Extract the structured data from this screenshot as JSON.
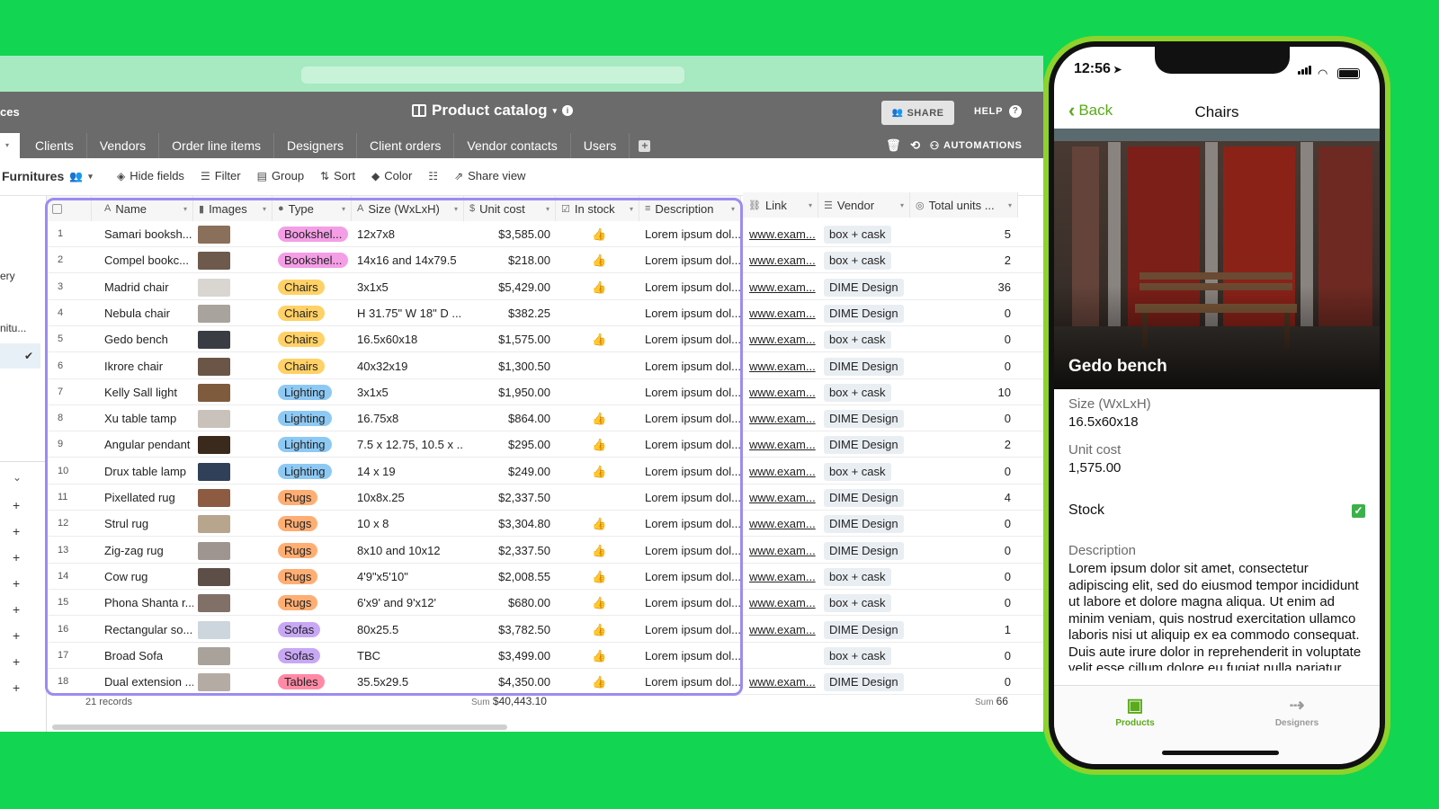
{
  "app": {
    "header_cut_text": "ces",
    "base_title": "Product catalog",
    "share_label": "SHARE",
    "help_label": "HELP",
    "automations_label": "AUTOMATIONS",
    "tabs": [
      "Clients",
      "Vendors",
      "Order line items",
      "Designers",
      "Client orders",
      "Vendor contacts",
      "Users"
    ],
    "view_name": "Furnitures",
    "toolbar": {
      "hide_fields": "Hide fields",
      "filter": "Filter",
      "group": "Group",
      "sort": "Sort",
      "color": "Color",
      "share_view": "Share view"
    },
    "left_strip": {
      "item1": "ery",
      "item2": "nitu..."
    }
  },
  "grid": {
    "columns": {
      "name": "Name",
      "images": "Images",
      "type": "Type",
      "size": "Size (WxLxH)",
      "unit_cost": "Unit cost",
      "in_stock": "In stock",
      "description": "Description",
      "link": "Link",
      "vendor": "Vendor",
      "total_units": "Total units ..."
    },
    "rows": [
      {
        "n": "1",
        "name": "Samari booksh...",
        "type": "Bookshel...",
        "size": "12x7x8",
        "cost": "$3,585.00",
        "stock": true,
        "desc": "Lorem ipsum dol...",
        "link": "www.exam...",
        "vendor": "box + cask",
        "units": "5"
      },
      {
        "n": "2",
        "name": "Compel bookc...",
        "type": "Bookshel...",
        "size": "14x16 and 14x79.5",
        "cost": "$218.00",
        "stock": true,
        "desc": "Lorem ipsum dol...",
        "link": "www.exam...",
        "vendor": "box + cask",
        "units": "2"
      },
      {
        "n": "3",
        "name": "Madrid chair",
        "type": "Chairs",
        "size": "3x1x5",
        "cost": "$5,429.00",
        "stock": true,
        "desc": "Lorem ipsum dol...",
        "link": "www.exam...",
        "vendor": "DIME Design",
        "units": "36"
      },
      {
        "n": "4",
        "name": "Nebula chair",
        "type": "Chairs",
        "size": "H 31.75\" W 18\" D ...",
        "cost": "$382.25",
        "stock": false,
        "desc": "Lorem ipsum dol...",
        "link": "www.exam...",
        "vendor": "DIME Design",
        "units": "0"
      },
      {
        "n": "5",
        "name": "Gedo bench",
        "type": "Chairs",
        "size": "16.5x60x18",
        "cost": "$1,575.00",
        "stock": true,
        "desc": "Lorem ipsum dol...",
        "link": "www.exam...",
        "vendor": "box + cask",
        "units": "0"
      },
      {
        "n": "6",
        "name": "Ikrore chair",
        "type": "Chairs",
        "size": "40x32x19",
        "cost": "$1,300.50",
        "stock": false,
        "desc": "Lorem ipsum dol...",
        "link": "www.exam...",
        "vendor": "DIME Design",
        "units": "0"
      },
      {
        "n": "7",
        "name": "Kelly Sall light",
        "type": "Lighting",
        "size": "3x1x5",
        "cost": "$1,950.00",
        "stock": false,
        "desc": "Lorem ipsum dol...",
        "link": "www.exam...",
        "vendor": "box + cask",
        "units": "10"
      },
      {
        "n": "8",
        "name": "Xu table tamp",
        "type": "Lighting",
        "size": "16.75x8",
        "cost": "$864.00",
        "stock": true,
        "desc": "Lorem ipsum dol...",
        "link": "www.exam...",
        "vendor": "DIME Design",
        "units": "0"
      },
      {
        "n": "9",
        "name": "Angular pendant",
        "type": "Lighting",
        "size": "7.5 x 12.75, 10.5 x ...",
        "cost": "$295.00",
        "stock": true,
        "desc": "Lorem ipsum dol...",
        "link": "www.exam...",
        "vendor": "DIME Design",
        "units": "2"
      },
      {
        "n": "10",
        "name": "Drux table lamp",
        "type": "Lighting",
        "size": "14 x 19",
        "cost": "$249.00",
        "stock": true,
        "desc": "Lorem ipsum dol...",
        "link": "www.exam...",
        "vendor": "box + cask",
        "units": "0"
      },
      {
        "n": "11",
        "name": "Pixellated rug",
        "type": "Rugs",
        "size": "10x8x.25",
        "cost": "$2,337.50",
        "stock": false,
        "desc": "Lorem ipsum dol...",
        "link": "www.exam...",
        "vendor": "DIME Design",
        "units": "4"
      },
      {
        "n": "12",
        "name": "Strul rug",
        "type": "Rugs",
        "size": "10 x 8",
        "cost": "$3,304.80",
        "stock": true,
        "desc": "Lorem ipsum dol...",
        "link": "www.exam...",
        "vendor": "DIME Design",
        "units": "0"
      },
      {
        "n": "13",
        "name": "Zig-zag rug",
        "type": "Rugs",
        "size": "8x10 and 10x12",
        "cost": "$2,337.50",
        "stock": true,
        "desc": "Lorem ipsum dol...",
        "link": "www.exam...",
        "vendor": "DIME Design",
        "units": "0"
      },
      {
        "n": "14",
        "name": "Cow rug",
        "type": "Rugs",
        "size": "4'9\"x5'10\"",
        "cost": "$2,008.55",
        "stock": true,
        "desc": "Lorem ipsum dol...",
        "link": "www.exam...",
        "vendor": "box + cask",
        "units": "0"
      },
      {
        "n": "15",
        "name": "Phona Shanta r...",
        "type": "Rugs",
        "size": "6'x9' and 9'x12'",
        "cost": "$680.00",
        "stock": true,
        "desc": "Lorem ipsum dol...",
        "link": "www.exam...",
        "vendor": "box + cask",
        "units": "0"
      },
      {
        "n": "16",
        "name": "Rectangular so...",
        "type": "Sofas",
        "size": "80x25.5",
        "cost": "$3,782.50",
        "stock": true,
        "desc": "Lorem ipsum dol...",
        "link": "www.exam...",
        "vendor": "DIME Design",
        "units": "1"
      },
      {
        "n": "17",
        "name": "Broad Sofa",
        "type": "Sofas",
        "size": "TBC",
        "cost": "$3,499.00",
        "stock": true,
        "desc": "Lorem ipsum dol...",
        "link": "",
        "vendor": "box + cask",
        "units": "0"
      },
      {
        "n": "18",
        "name": "Dual extension ...",
        "type": "Tables",
        "size": "35.5x29.5",
        "cost": "$4,350.00",
        "stock": true,
        "desc": "Lorem ipsum dol...",
        "link": "www.exam...",
        "vendor": "DIME Design",
        "units": "0"
      }
    ],
    "type_colors": {
      "Bookshel...": "#f49ee6",
      "Chairs": "#ffd166",
      "Lighting": "#8ec9f4",
      "Rugs": "#ffae73",
      "Sofas": "#c8a8f5",
      "Tables": "#ff8aa6"
    },
    "footer": {
      "records": "21 records",
      "sum_label": "Sum",
      "sum_cost": "$40,443.10",
      "sum_units": "66"
    }
  },
  "phone": {
    "time": "12:56",
    "back_label": "Back",
    "nav_title": "Chairs",
    "record_name": "Gedo bench",
    "size_label": "Size (WxLxH)",
    "size_value": "16.5x60x18",
    "cost_label": "Unit cost",
    "cost_value": "1,575.00",
    "stock_label": "Stock",
    "desc_label": "Description",
    "desc_value": "Lorem ipsum dolor sit amet, consectetur adipiscing elit, sed do eiusmod tempor incididunt ut labore et dolore magna aliqua. Ut enim ad minim veniam, quis nostrud exercitation ullamco laboris nisi ut aliquip ex ea commodo consequat. Duis aute irure dolor in reprehenderit in voluptate velit esse cillum dolore eu fugiat nulla pariatur.",
    "tab_products": "Products",
    "tab_designers": "Designers"
  },
  "colors": {
    "background": "#12d651",
    "accent_purple": "#9b8cf2",
    "phone_accent": "#5aaa1a"
  }
}
